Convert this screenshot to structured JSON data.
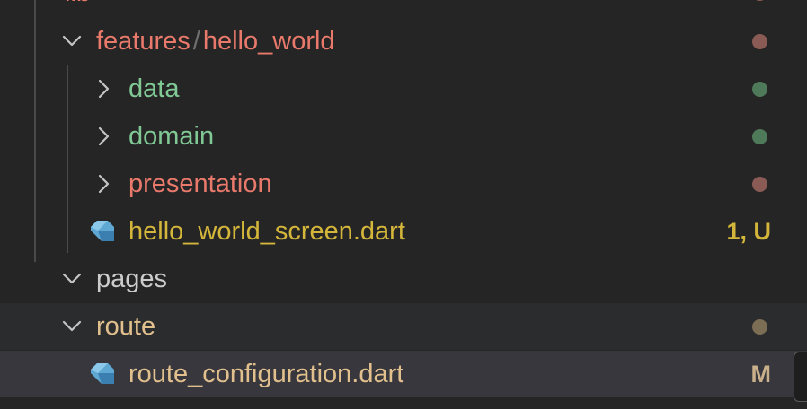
{
  "tree": {
    "lib": {
      "label": "lib",
      "color": "#e8796b",
      "dot": "#8a5a55"
    },
    "features": {
      "label_a": "features",
      "separator": "/",
      "label_b": "hello_world",
      "color": "#e8796b",
      "dot": "#8a5a55"
    },
    "data": {
      "label": "data",
      "color": "#80c995",
      "dot": "#4f7a5a"
    },
    "domain": {
      "label": "domain",
      "color": "#80c995",
      "dot": "#4f7a5a"
    },
    "presentation": {
      "label": "presentation",
      "color": "#e8796b",
      "dot": "#8a5a55"
    },
    "hello_screen": {
      "label": "hello_world_screen.dart",
      "color": "#d4b63a",
      "badge": "1, U",
      "badge_color": "#d4b63a",
      "icon": "dart-icon"
    },
    "pages": {
      "label": "pages",
      "color": "#cccccc"
    },
    "route": {
      "label": "route",
      "color": "#e2c08d",
      "dot": "#7c6e55"
    },
    "route_config": {
      "label": "route_configuration.dart",
      "color": "#e2c08d",
      "badge": "M",
      "badge_color": "#c9b08a",
      "icon": "dart-icon"
    }
  },
  "colors": {
    "background": "#252526",
    "hover_row": "#2b2c2e",
    "selected_row": "#37373d",
    "indent_guide": "#4a4a4a",
    "chevron": "#c5c5c5",
    "dart_icon": "#5fa8d3"
  }
}
